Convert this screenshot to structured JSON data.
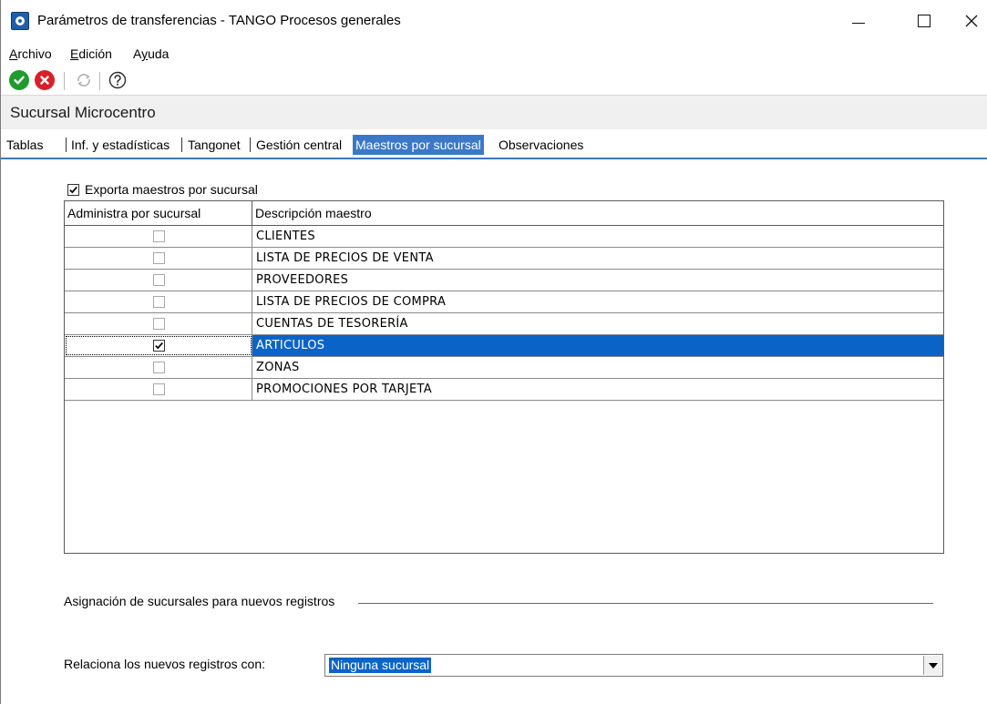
{
  "window": {
    "title": "Parámetros de transferencias - TANGO Procesos generales"
  },
  "menu": {
    "items": [
      {
        "label": "Archivo",
        "underline": "A",
        "rest": "rchivo"
      },
      {
        "label": "Edición",
        "underline": "E",
        "rest": "dición"
      },
      {
        "label": "Ayuda",
        "pre": "A",
        "underline": "y",
        "rest": "uda"
      }
    ]
  },
  "toolbar": {
    "icons": [
      "check-circle-icon",
      "cancel-circle-icon",
      "refresh-icon",
      "help-icon"
    ],
    "colors": {
      "ok": "#1f9b2e",
      "cancel": "#d8202a",
      "disabled": "#b0b0b0"
    }
  },
  "branch": {
    "title": "Sucursal Microcentro"
  },
  "tabs": [
    {
      "label": "Tablas",
      "active": false
    },
    {
      "label": "Inf. y estadísticas",
      "active": false
    },
    {
      "label": "Tangonet",
      "active": false
    },
    {
      "label": "Gestión central",
      "active": false
    },
    {
      "label": "Maestros por sucursal",
      "active": true
    },
    {
      "label": "Observaciones",
      "active": false
    }
  ],
  "export": {
    "label": "Exporta maestros por sucursal",
    "checked": true
  },
  "grid": {
    "columns": [
      "Administra por sucursal",
      "Descripción maestro"
    ],
    "rows": [
      {
        "checked": false,
        "description": "CLIENTES",
        "selected": false
      },
      {
        "checked": false,
        "description": "LISTA DE PRECIOS DE VENTA",
        "selected": false
      },
      {
        "checked": false,
        "description": "PROVEEDORES",
        "selected": false
      },
      {
        "checked": false,
        "description": "LISTA DE PRECIOS DE COMPRA",
        "selected": false
      },
      {
        "checked": false,
        "description": "CUENTAS DE TESORERÍA",
        "selected": false
      },
      {
        "checked": true,
        "description": "ARTICULOS",
        "selected": true
      },
      {
        "checked": false,
        "description": "ZONAS",
        "selected": false
      },
      {
        "checked": false,
        "description": "PROMOCIONES POR TARJETA",
        "selected": false
      }
    ]
  },
  "assignment": {
    "section_title": "Asignación de sucursales para nuevos registros",
    "relate_label": "Relaciona los nuevos registros con:",
    "selected_value": "Ninguna sucursal"
  },
  "colors": {
    "selection": "#0a64c8",
    "active_tab": "#3c78c8"
  }
}
